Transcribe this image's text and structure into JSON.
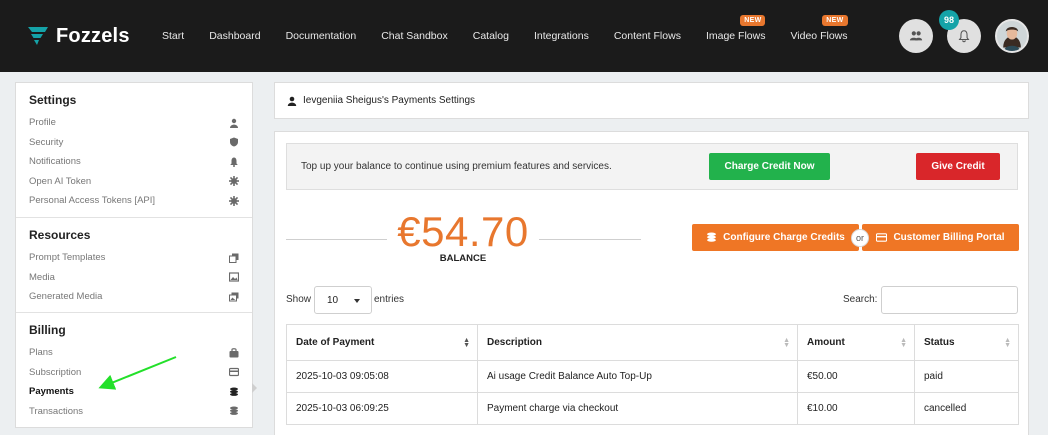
{
  "brand": {
    "name": "Fozzels",
    "accent": "#15a3a8"
  },
  "nav": {
    "items": [
      {
        "label": "Start",
        "badge": ""
      },
      {
        "label": "Dashboard",
        "badge": ""
      },
      {
        "label": "Documentation",
        "badge": ""
      },
      {
        "label": "Chat Sandbox",
        "badge": ""
      },
      {
        "label": "Catalog",
        "badge": ""
      },
      {
        "label": "Integrations",
        "badge": ""
      },
      {
        "label": "Content Flows",
        "badge": ""
      },
      {
        "label": "Image Flows",
        "badge": "NEW"
      },
      {
        "label": "Video Flows",
        "badge": "NEW"
      }
    ],
    "notification_count": "98"
  },
  "sidebar": {
    "settings_title": "Settings",
    "settings": [
      {
        "label": "Profile",
        "icon": "user-icon"
      },
      {
        "label": "Security",
        "icon": "shield-icon"
      },
      {
        "label": "Notifications",
        "icon": "bell-icon"
      },
      {
        "label": "Open AI Token",
        "icon": "gear-icon"
      },
      {
        "label": "Personal Access Tokens [API]",
        "icon": "gear-icon"
      }
    ],
    "resources_title": "Resources",
    "resources": [
      {
        "label": "Prompt Templates",
        "icon": "copy-icon"
      },
      {
        "label": "Media",
        "icon": "image-icon"
      },
      {
        "label": "Generated Media",
        "icon": "images-icon"
      }
    ],
    "billing_title": "Billing",
    "billing": [
      {
        "label": "Plans",
        "icon": "bag-icon"
      },
      {
        "label": "Subscription",
        "icon": "card-icon"
      },
      {
        "label": "Payments",
        "icon": "coins-icon"
      },
      {
        "label": "Transactions",
        "icon": "coins-icon"
      }
    ]
  },
  "header": {
    "title": "Ievgeniia Sheigus's Payments Settings"
  },
  "topup": {
    "text": "Top up your balance to continue using premium features and services.",
    "charge_label": "Charge Credit Now",
    "give_label": "Give Credit"
  },
  "balance": {
    "amount": "€54.70",
    "label": "BALANCE"
  },
  "actions": {
    "configure_label": "Configure Charge Credits",
    "or_label": "or",
    "portal_label": "Customer Billing Portal"
  },
  "table_controls": {
    "show_label": "Show",
    "entries_value": "10",
    "entries_label": "entries",
    "search_label": "Search:"
  },
  "table": {
    "headers": [
      "Date of Payment",
      "Description",
      "Amount",
      "Status"
    ],
    "rows": [
      [
        "2025-10-03 09:05:08",
        "Ai usage Credit Balance Auto Top-Up",
        "€50.00",
        "paid"
      ],
      [
        "2025-10-03 06:09:25",
        "Payment charge via checkout",
        "€10.00",
        "cancelled"
      ]
    ]
  }
}
